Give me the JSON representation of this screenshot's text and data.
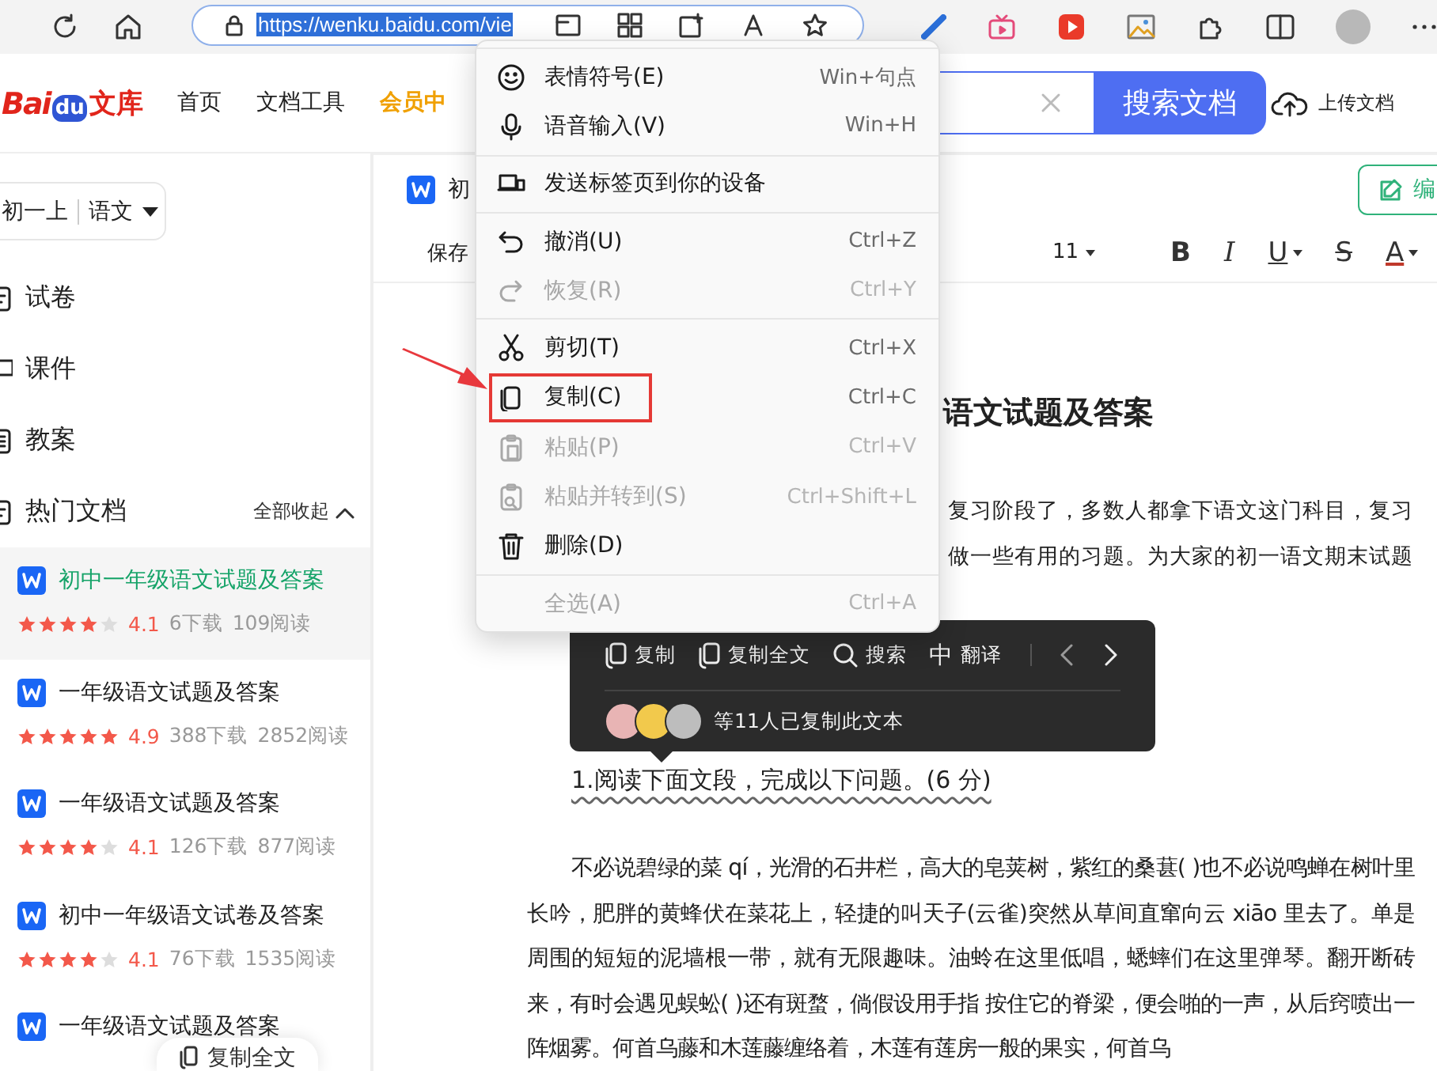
{
  "browser": {
    "url": "https://wenku.baidu.com/vie"
  },
  "header": {
    "logo": {
      "part_1": "Bai",
      "part_2": "du",
      "part_3": "文库"
    },
    "nav": [
      {
        "label": "首页",
        "kind": "normal"
      },
      {
        "label": "文档工具",
        "kind": "normal"
      },
      {
        "label": "会员中",
        "kind": "vip"
      }
    ],
    "search_button": "搜索文档",
    "upload": "上传文档"
  },
  "sidebar": {
    "grade": "初一上",
    "subject": "语文",
    "categories": [
      {
        "label": "试卷"
      },
      {
        "label": "课件"
      },
      {
        "label": "教案"
      }
    ],
    "hot": {
      "title": "热门文档",
      "toggle": "全部收起",
      "expanded": true
    },
    "docs": [
      {
        "title": "初中一年级语文试题及答案",
        "selected": true,
        "stars": 4,
        "rating": "4.1",
        "downloads": "6下载",
        "reads": "109阅读"
      },
      {
        "title": "一年级语文试题及答案",
        "selected": false,
        "stars": 5,
        "rating": "4.9",
        "downloads": "388下载",
        "reads": "2852阅读"
      },
      {
        "title": "一年级语文试题及答案",
        "selected": false,
        "stars": 4,
        "rating": "4.1",
        "downloads": "126下载",
        "reads": "877阅读"
      },
      {
        "title": "初中一年级语文试卷及答案",
        "selected": false,
        "stars": 4,
        "rating": "4.1",
        "downloads": "76下载",
        "reads": "1535阅读"
      },
      {
        "title": "一年级语文试题及答案",
        "selected": false
      }
    ]
  },
  "floating_button": "复制全文",
  "editor": {
    "doc_tab": "初",
    "save": "保存",
    "font_size": "11",
    "format_tools": [
      {
        "label": "B",
        "kind": "bold",
        "dropdown": false
      },
      {
        "label": "I",
        "kind": "italic",
        "dropdown": false
      },
      {
        "label": "U",
        "kind": "underline",
        "dropdown": true
      },
      {
        "label": "S",
        "kind": "strike",
        "dropdown": false
      },
      {
        "label": "A",
        "kind": "color",
        "dropdown": true
      }
    ],
    "edit_button": "编",
    "title": "语文试题及答案",
    "intro_lines": [
      "复习阶段了，多数人都拿下语文这门科目，复习",
      "做一些有用的习题。为大家的初一语文期末试题"
    ],
    "question": "1.阅读下面文段，完成以下问题。(6 分)",
    "passage": "不必说碧绿的菜 qí，光滑的石井栏，高大的皂荚树，紫红的桑葚( )也不必说鸣蝉在树叶里长吟，肥胖的黄蜂伏在菜花上，轻捷的叫天子(云雀)突然从草间直窜向云 xiāo 里去了。单是周围的短短的泥墙根一带，就有无限趣味。油蛉在这里低唱，蟋蟀们在这里弹琴。翻开断砖来，有时会遇见蜈蚣( )还有斑蝥，倘假设用手指 按住它的脊梁，便会啪的一声，从后窍喷出一阵烟雾。何首乌藤和木莲藤缠络着，木莲有莲房一般的果实，何首乌"
  },
  "context_menu": {
    "groups": [
      {
        "items": [
          {
            "kind": "smiley",
            "label": "表情符号(E)",
            "shortcut": "Win+句点",
            "disabled": false,
            "highlighted": false
          },
          {
            "kind": "mic",
            "label": "语音输入(V)",
            "shortcut": "Win+H",
            "disabled": false,
            "highlighted": false
          }
        ]
      },
      {
        "items": [
          {
            "kind": "device",
            "label": "发送标签页到你的设备",
            "disabled": false,
            "highlighted": false
          }
        ]
      },
      {
        "items": [
          {
            "kind": "undo",
            "label": "撤消(U)",
            "shortcut": "Ctrl+Z",
            "disabled": false,
            "highlighted": false
          },
          {
            "kind": "redo",
            "label": "恢复(R)",
            "shortcut": "Ctrl+Y",
            "disabled": true,
            "highlighted": false
          }
        ]
      },
      {
        "items": [
          {
            "kind": "scissors",
            "label": "剪切(T)",
            "shortcut": "Ctrl+X",
            "disabled": false,
            "highlighted": false
          },
          {
            "kind": "copy",
            "label": "复制(C)",
            "shortcut": "Ctrl+C",
            "disabled": false,
            "highlighted": true
          },
          {
            "kind": "paste",
            "label": "粘贴(P)",
            "shortcut": "Ctrl+V",
            "disabled": true,
            "highlighted": false
          },
          {
            "kind": "paste_go",
            "label": "粘贴并转到(S)",
            "shortcut": "Ctrl+Shift+L",
            "disabled": true,
            "highlighted": false
          },
          {
            "kind": "trash",
            "label": "删除(D)",
            "disabled": false,
            "highlighted": false
          }
        ]
      },
      {
        "items": [
          {
            "kind": "select_all",
            "label": "全选(A)",
            "shortcut": "Ctrl+A",
            "disabled": true,
            "highlighted": false
          }
        ]
      }
    ]
  },
  "copy_popup": {
    "actions": [
      {
        "kind": "copy",
        "label": "复制"
      },
      {
        "kind": "copy_all",
        "label": "复制全文"
      },
      {
        "kind": "search",
        "label": "搜索"
      },
      {
        "kind": "translate",
        "icon_text": "中",
        "label": "翻译"
      }
    ],
    "caption": "等11人已复制此文本"
  }
}
